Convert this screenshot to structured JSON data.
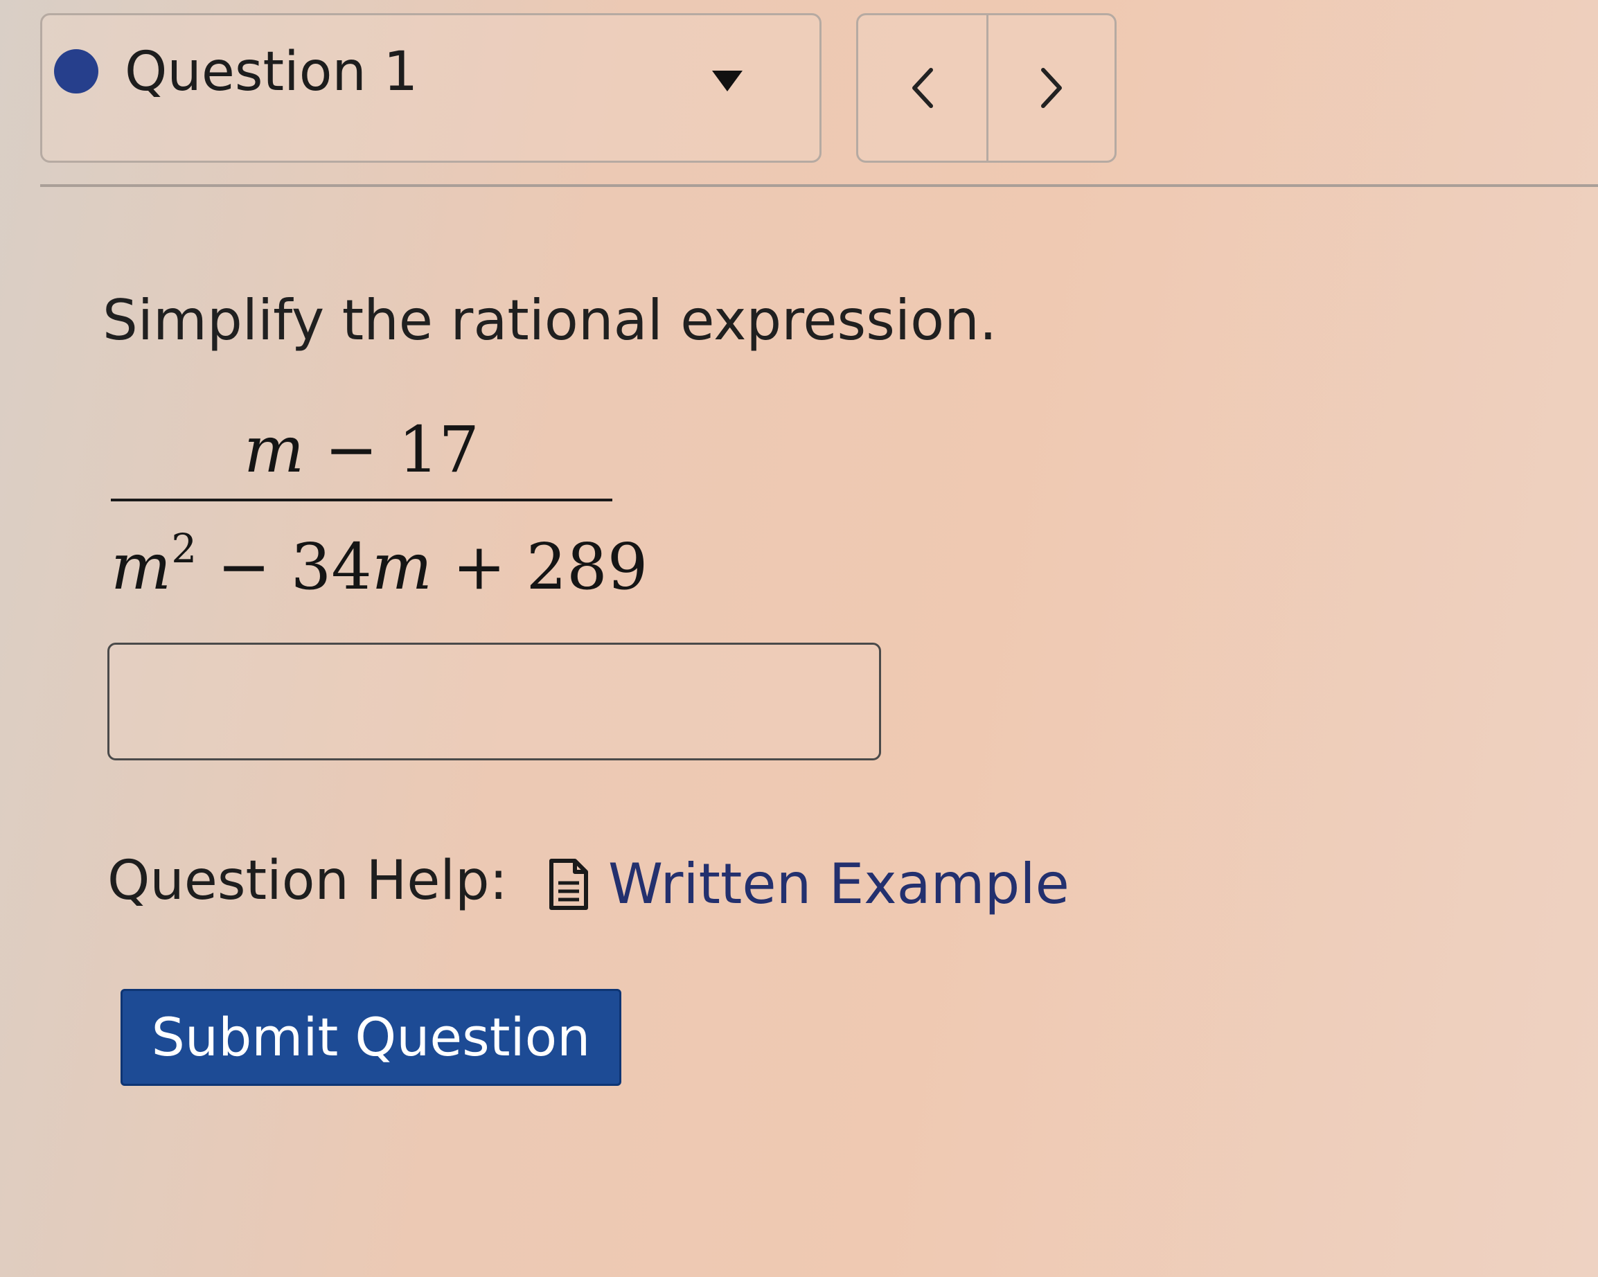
{
  "header": {
    "question_selector": {
      "label": "Question 1",
      "status_dot_icon": "filled-circle-icon",
      "status_color": "#263f8c",
      "dropdown_icon": "caret-down-icon"
    },
    "nav": {
      "prev_icon": "chevron-left-icon",
      "next_icon": "chevron-right-icon"
    }
  },
  "question": {
    "prompt": "Simplify the rational expression.",
    "expression": {
      "numerator": {
        "var": "m",
        "rest": " − 17"
      },
      "denominator": {
        "var1": "m",
        "exponent": "2",
        "middle": " − 34",
        "var2": "m",
        "rest": " + 289"
      }
    }
  },
  "answer": {
    "value": "",
    "placeholder": ""
  },
  "help": {
    "label": "Question Help:",
    "link_icon": "document-icon",
    "link_text": "Written Example",
    "link_color": "#23306e"
  },
  "submit": {
    "label": "Submit Question",
    "color": "#1d4b95"
  }
}
